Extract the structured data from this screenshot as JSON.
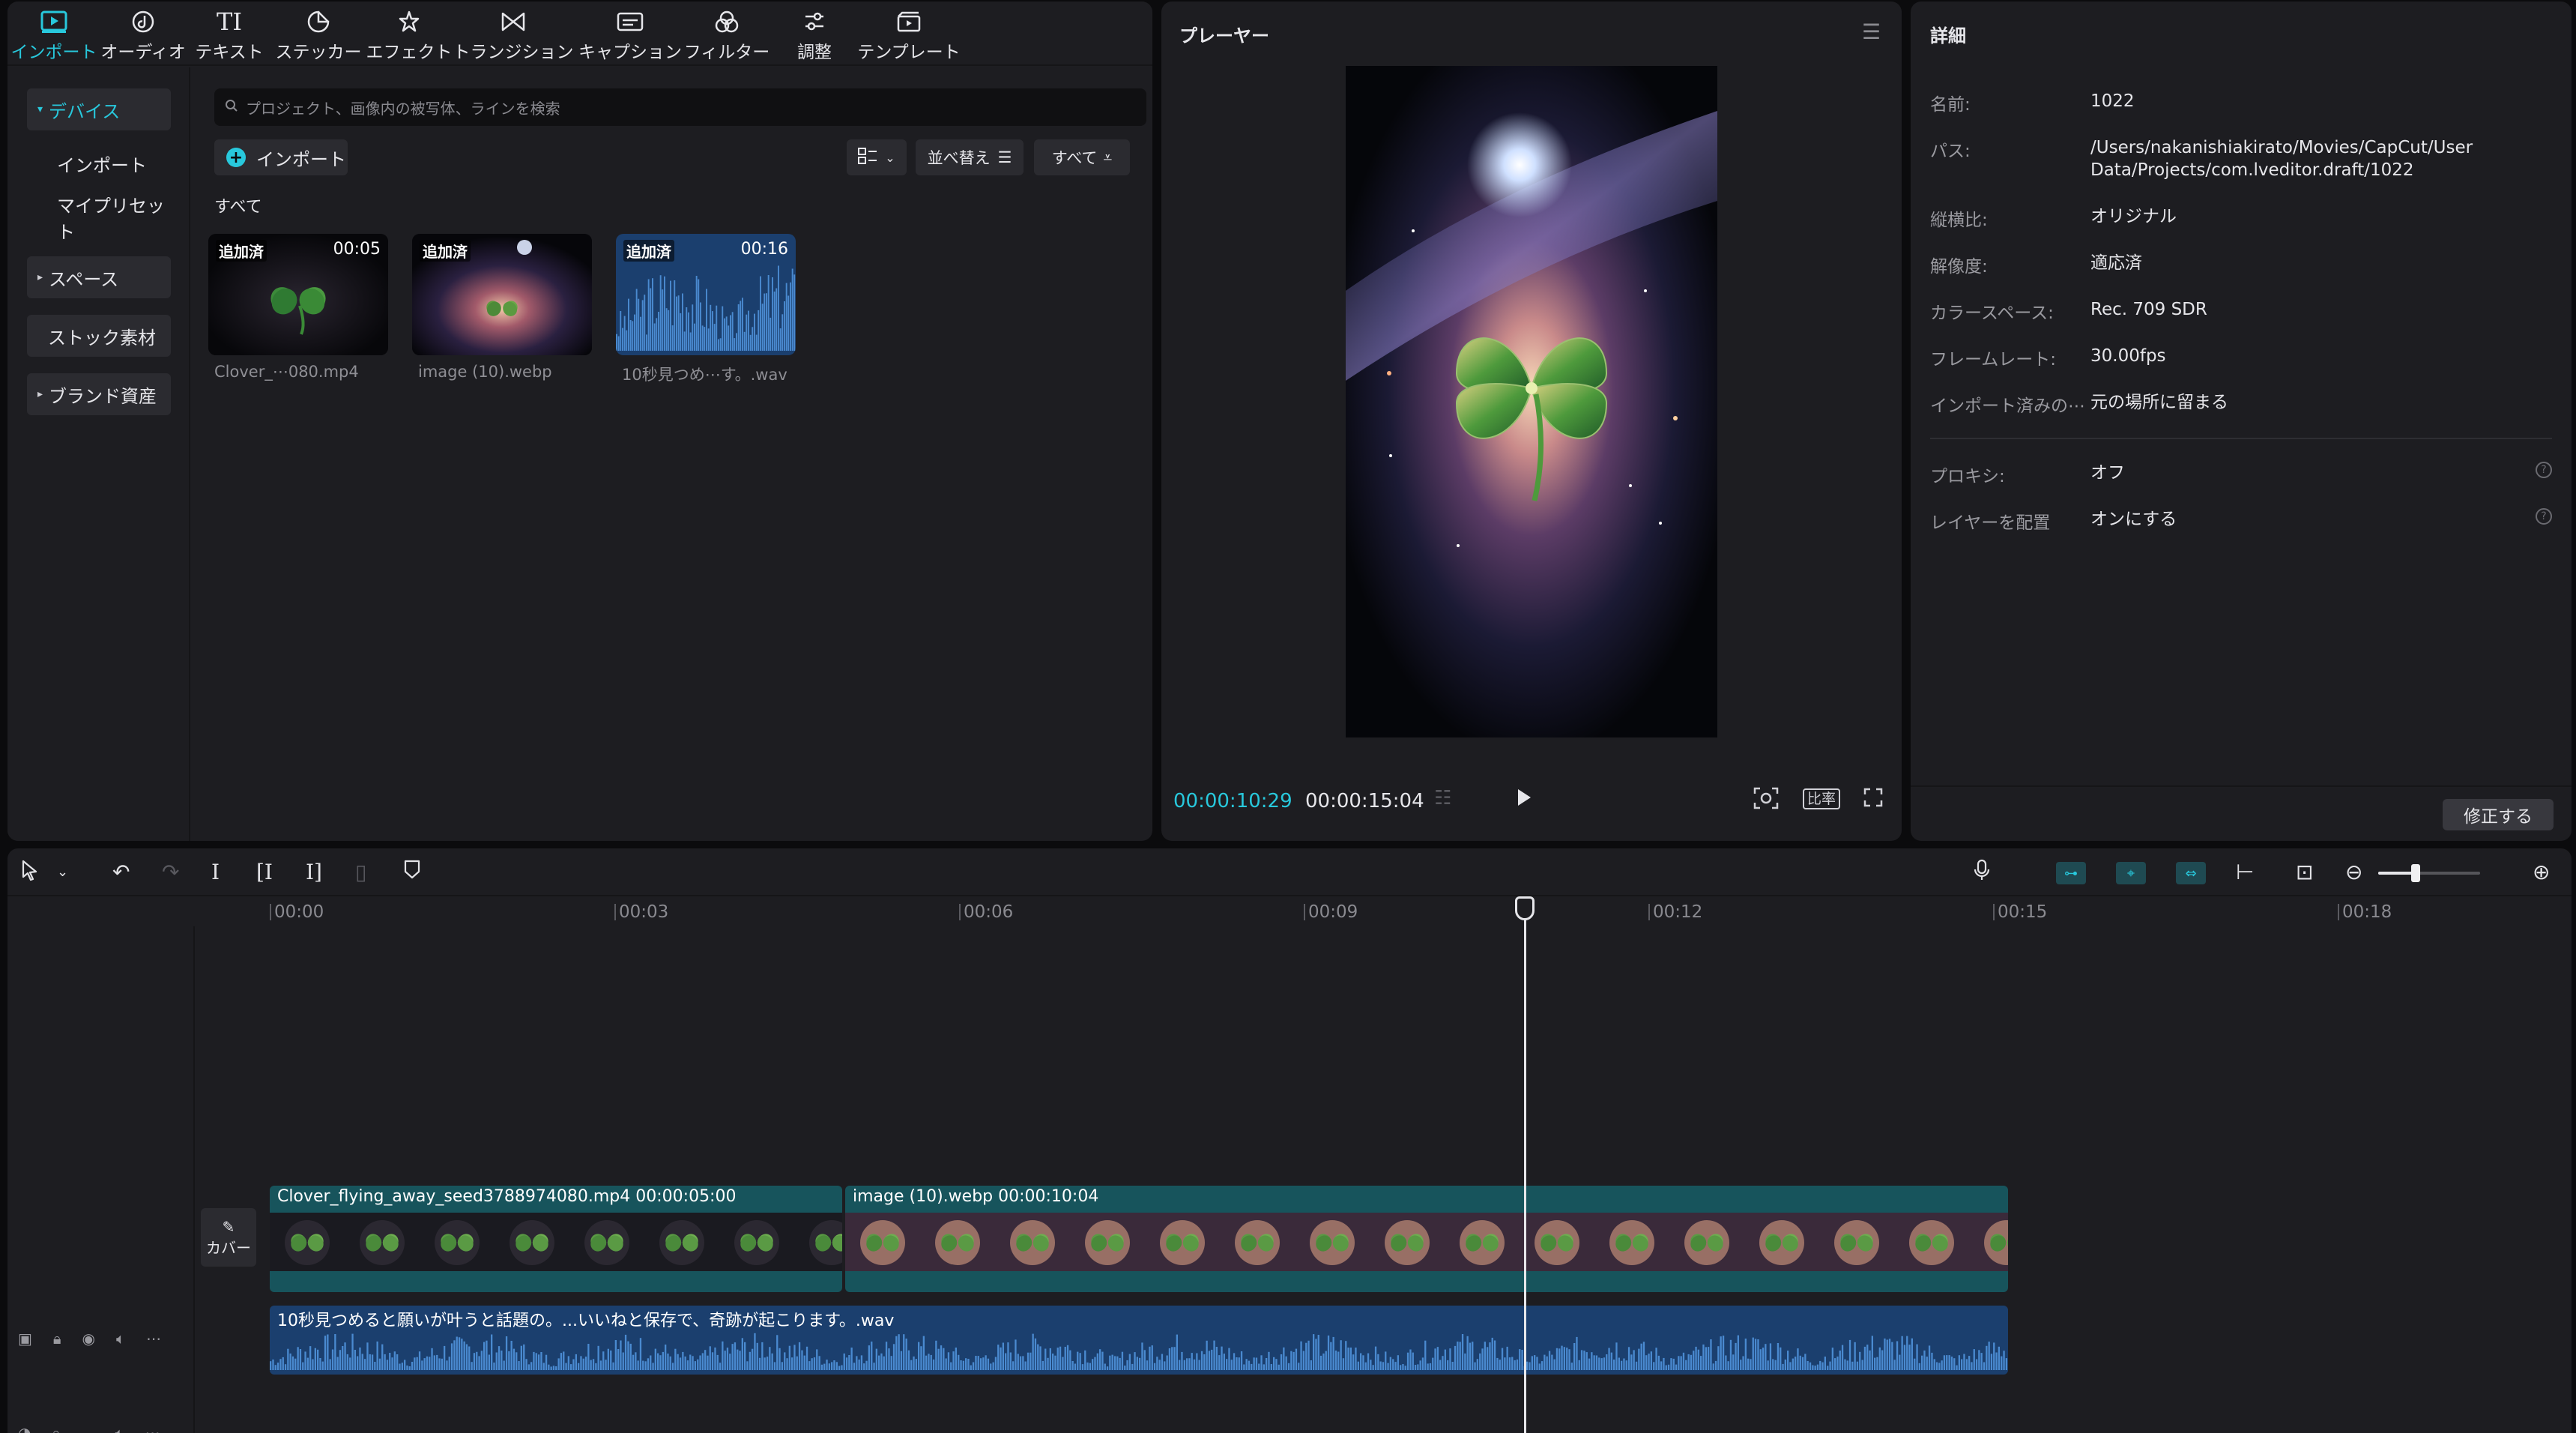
{
  "toolbar": {
    "items": [
      {
        "label": "インポート",
        "icon": "import-icon",
        "active": true
      },
      {
        "label": "オーディオ",
        "icon": "audio-icon"
      },
      {
        "label": "テキスト",
        "icon": "text-icon",
        "glyph": "TI"
      },
      {
        "label": "ステッカー",
        "icon": "sticker-icon"
      },
      {
        "label": "エフェクト",
        "icon": "effect-icon"
      },
      {
        "label": "トランジション",
        "icon": "transition-icon"
      },
      {
        "label": "キャプション",
        "icon": "caption-icon"
      },
      {
        "label": "フィルター",
        "icon": "filter-icon"
      },
      {
        "label": "調整",
        "icon": "adjust-icon"
      },
      {
        "label": "テンプレート",
        "icon": "template-icon"
      }
    ]
  },
  "sidebar": {
    "items": [
      {
        "label": "デバイス",
        "expandable": true,
        "active": true
      },
      {
        "label": "インポート"
      },
      {
        "label": "マイプリセット"
      },
      {
        "label": "スペース",
        "expandable": true
      },
      {
        "label": "ストック素材"
      },
      {
        "label": "ブランド資産",
        "expandable": true
      }
    ]
  },
  "media": {
    "search_placeholder": "プロジェクト、画像内の被写体、ラインを検索",
    "import_label": "インポート",
    "sort_label": "並べ替え",
    "filter_label": "すべて",
    "section_label": "すべて",
    "items": [
      {
        "badge": "追加済",
        "duration": "00:05",
        "name": "Clover_⋯080.mp4",
        "kind": "video"
      },
      {
        "badge": "追加済",
        "duration": "",
        "name": "image (10).webp",
        "kind": "image"
      },
      {
        "badge": "追加済",
        "duration": "00:16",
        "name": "10秒見つめ⋯す。.wav",
        "kind": "audio"
      }
    ]
  },
  "player": {
    "title": "プレーヤー",
    "time_current": "00:00:10:29",
    "time_total": "00:00:15:04",
    "ratio_label": "比率"
  },
  "details": {
    "title": "詳細",
    "rows": [
      {
        "key": "名前:",
        "value": "1022"
      },
      {
        "key": "パス:",
        "value": "/Users/nakanishiakirato/Movies/CapCut/User Data/Projects/com.lveditor.draft/1022"
      },
      {
        "key": "縦横比:",
        "value": "オリジナル"
      },
      {
        "key": "解像度:",
        "value": "適応済"
      },
      {
        "key": "カラースペース:",
        "value": "Rec. 709 SDR"
      },
      {
        "key": "フレームレート:",
        "value": "30.00fps"
      },
      {
        "key": "インポート済みの⋯",
        "value": "元の場所に留まる"
      }
    ],
    "settings": [
      {
        "key": "プロキシ:",
        "value": "オフ"
      },
      {
        "key": "レイヤーを配置",
        "value": "オンにする"
      }
    ],
    "modify_label": "修正する"
  },
  "timeline": {
    "ruler": [
      "00:00",
      "00:03",
      "00:06",
      "00:09",
      "00:12",
      "00:15",
      "00:18"
    ],
    "cover_label": "カバー",
    "clips": {
      "video1_title": "Clover_flying_away_seed3788974080.mp4  00:00:05:00",
      "video2_title": "image (10).webp   00:00:10:04",
      "audio_title": "10秒見つめると願いが叶うと話題の。...いいねと保存で、奇跡が起こります。.wav"
    },
    "playhead_time_seconds": 10.97
  },
  "colors": {
    "accent": "#28c8dc",
    "video_clip": "#17545c",
    "audio_clip": "#1b3f6e"
  }
}
